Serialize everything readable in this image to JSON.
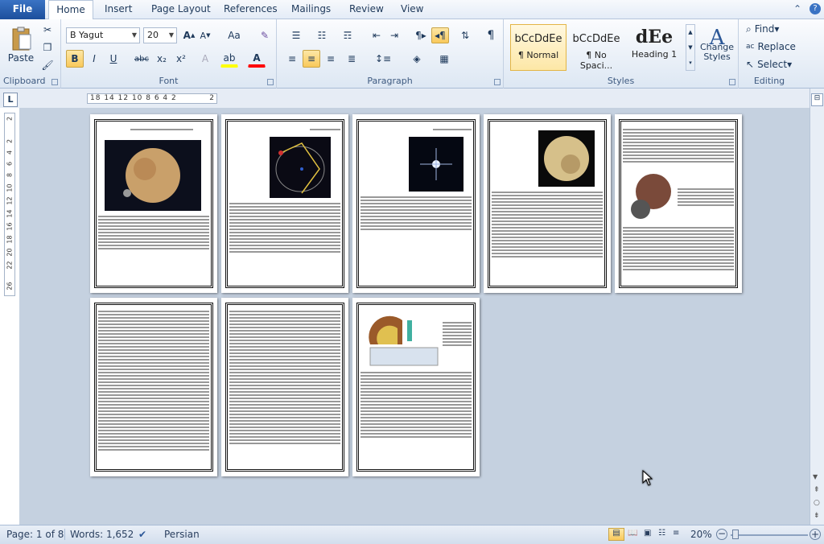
{
  "tabs": {
    "file": "File",
    "home": "Home",
    "insert": "Insert",
    "page_layout": "Page Layout",
    "references": "References",
    "mailings": "Mailings",
    "review": "Review",
    "view": "View"
  },
  "clipboard": {
    "paste": "Paste",
    "label": "Clipboard"
  },
  "font": {
    "name": "B Yagut",
    "size": "20",
    "label": "Font",
    "bold": "B",
    "italic": "I",
    "underline": "U",
    "strike": "abc",
    "sub": "x₂",
    "sup": "x²",
    "case": "Aa"
  },
  "paragraph": {
    "label": "Paragraph"
  },
  "styles": {
    "label": "Styles",
    "items": [
      {
        "sample": "bCcDdEe",
        "name": "¶ Normal"
      },
      {
        "sample": "bCcDdEe",
        "name": "¶ No Spaci..."
      },
      {
        "sample": "dEe",
        "name": "Heading 1"
      }
    ],
    "change": "Change Styles"
  },
  "editing": {
    "find": "Find",
    "replace": "Replace",
    "select": "Select",
    "label": "Editing"
  },
  "ruler": {
    "tab": "L",
    "h": "18  14 12 10  8  6  4  2",
    "h_right": "2",
    "v": [
      "2",
      "2",
      "4",
      "6",
      "8",
      "10",
      "12",
      "14",
      "16",
      "18",
      "20",
      "22",
      "26"
    ]
  },
  "status": {
    "page": "Page: 1 of 8",
    "words": "Words: 1,652",
    "lang": "Persian",
    "zoom": "20%"
  },
  "colors": {
    "accent": "#2b5797",
    "highlight": "#ffff00",
    "font_color": "#ff0000"
  }
}
